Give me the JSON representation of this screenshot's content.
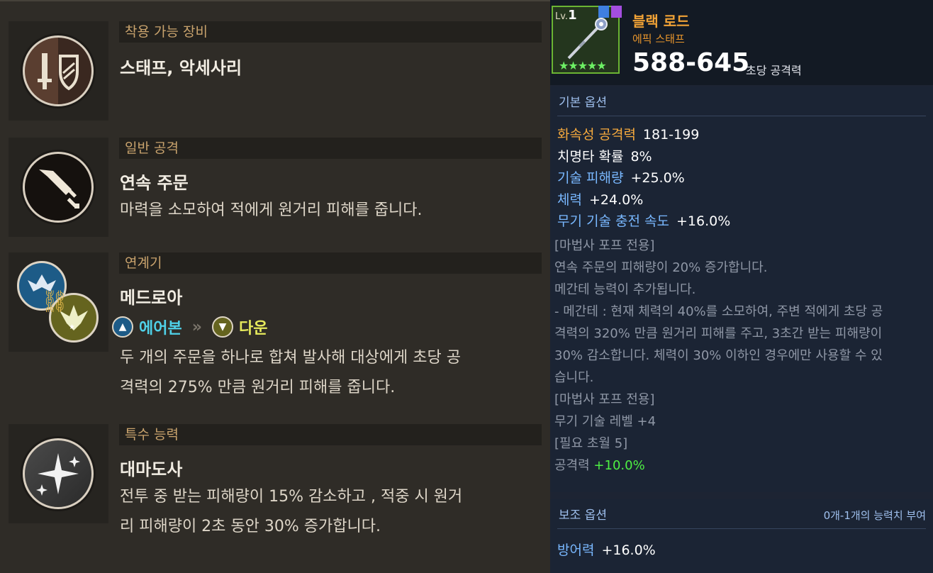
{
  "left": {
    "sections": [
      {
        "header": "착용 가능 장비",
        "name": "스태프, 악세사리"
      },
      {
        "header": "일반 공격",
        "name": "연속 주문",
        "desc": "마력을 소모하여 적에게 원거리 피해를 줍니다."
      },
      {
        "header": "연계기",
        "name": "메드로아",
        "combo": {
          "from": "에어본",
          "to": "다운"
        },
        "desc": [
          "두 개의 주문을 하나로 합쳐 발사해 대상에게 초당 공",
          "격력의 275% 만큼 원거리 피해를 줍니다."
        ]
      },
      {
        "header": "특수 능력",
        "name": "대마도사",
        "desc": [
          "전투 중 받는 피해량이 15% 감소하고 , 적중 시 원거",
          "리 피해량이 2초 동안 30% 증가합니다."
        ]
      }
    ]
  },
  "item": {
    "level_label": "Lv.",
    "level": "1",
    "stars": "★★★★★",
    "name": "블랙 로드",
    "type": "에픽 스태프",
    "attack": "588-645",
    "attack_label": "초당 공격력",
    "basic": {
      "title": "기본 옵션",
      "stats": [
        {
          "k": "화속성 공격력",
          "v": "181-199",
          "color": "#f5a93d"
        },
        {
          "k": "치명타 확률",
          "v": "8%",
          "color": "#ffffff"
        },
        {
          "k": "기술 피해량",
          "v": "+25.0%",
          "color": "#79b8ff"
        },
        {
          "k": "체력",
          "v": "+24.0%",
          "color": "#79b8ff"
        },
        {
          "k": "무기 기술 충전 속도",
          "v": "+16.0%",
          "color": "#79b8ff"
        }
      ],
      "lines": [
        "[마법사 포프 전용]",
        "연속 주문의 피해량이 20% 증가합니다.",
        "메간테 능력이 추가됩니다.",
        "- 메간테 : 현재 체력의 40%를 소모하여, 주변 적에게 초당 공",
        "격력의 320% 만큼 원거리 피해를 주고, 3초간 받는 피해량이",
        "30% 감소합니다. 체력이 30% 이하인 경우에만 사용할 수 있",
        "습니다.",
        "[마법사 포프 전용]",
        "무기 기술 레벨 +4",
        "[필요 초월 5]"
      ],
      "bonus_key": "공격력",
      "bonus_value": "+10.0%"
    },
    "sub": {
      "title": "보조 옵션",
      "range": "0개-1개의 능력치 부여",
      "stat_key": "방어력",
      "stat_value": "+16.0%"
    }
  }
}
